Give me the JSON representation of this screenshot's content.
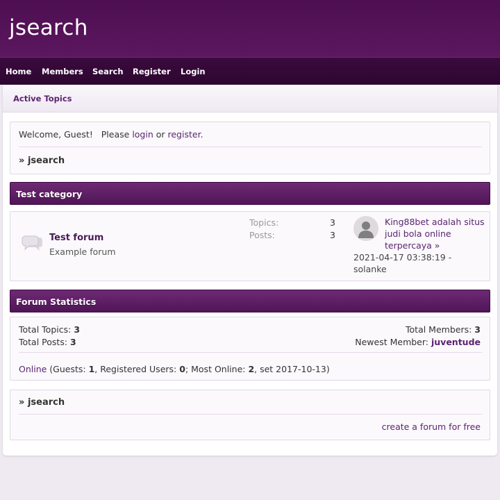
{
  "site": {
    "title": "jsearch"
  },
  "nav": [
    {
      "label": "Home"
    },
    {
      "label": "Members"
    },
    {
      "label": "Search"
    },
    {
      "label": "Register"
    },
    {
      "label": "Login"
    }
  ],
  "subbar": {
    "active_topics": "Active Topics"
  },
  "welcome": {
    "prefix": "Welcome, Guest!   Please ",
    "login": "login",
    "or": " or ",
    "register": "register",
    "period": ".",
    "breadcrumb_arrow": "»",
    "breadcrumb": "jsearch"
  },
  "category": {
    "title": "Test category",
    "forum": {
      "name": "Test forum",
      "description": "Example forum",
      "topics_label": "Topics:",
      "topics": "3",
      "posts_label": "Posts:",
      "posts": "3",
      "last_post": {
        "title_line1": "King88bet adalah situs",
        "title_line2": "judi bola online",
        "title_line3": "terpercaya",
        "arrow": "»",
        "date": "2021-04-17 03:38:19 -",
        "author": "solanke"
      }
    }
  },
  "stats": {
    "title": "Forum Statistics",
    "total_topics_label": "Total Topics: ",
    "total_topics": "3",
    "total_posts_label": "Total Posts: ",
    "total_posts": "3",
    "total_members_label": "Total Members: ",
    "total_members": "3",
    "newest_member_label": "Newest Member: ",
    "newest_member": "juventude",
    "online_link": "Online",
    "online_a": " (Guests: ",
    "guests": "1",
    "online_b": ", Registered Users: ",
    "registered": "0",
    "online_c": "; Most Online: ",
    "most_online": "2",
    "online_d": ", set 2017-10-13)"
  },
  "footer": {
    "breadcrumb_arrow": "»",
    "breadcrumb": "jsearch",
    "create_link": "create a forum for free"
  }
}
